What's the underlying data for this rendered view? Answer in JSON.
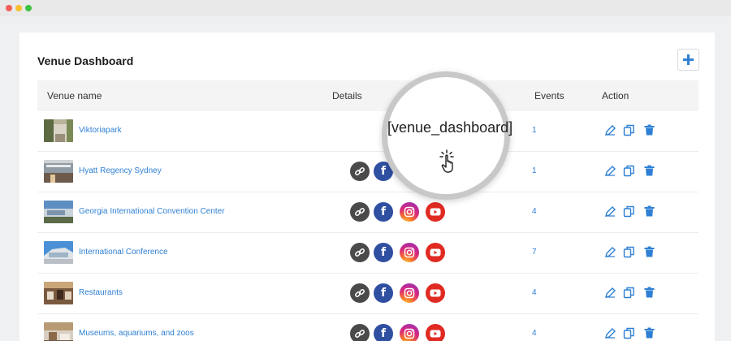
{
  "page": {
    "title": "Venue Dashboard"
  },
  "table": {
    "headers": {
      "venue_name": "Venue name",
      "details": "Details",
      "events": "Events",
      "action": "Action"
    },
    "rows": [
      {
        "name": "Viktoriapark",
        "events": "1"
      },
      {
        "name": "Hyatt Regency Sydney",
        "events": "1"
      },
      {
        "name": "Georgia International Convention Center",
        "events": "4"
      },
      {
        "name": "International Conference",
        "events": "7"
      },
      {
        "name": "Restaurants",
        "events": "4"
      },
      {
        "name": "Museums, aquariums, and zoos",
        "events": "4"
      }
    ]
  },
  "magnifier": {
    "shortcode": "[venue_dashboard]"
  },
  "icons": {
    "add": "plus-icon",
    "link": "link-icon",
    "facebook": "facebook-icon",
    "instagram": "instagram-icon",
    "youtube": "youtube-icon",
    "edit": "pencil-icon",
    "copy": "copy-icon",
    "delete": "trash-icon",
    "cursor": "pointer-click-icon"
  },
  "colors": {
    "accent": "#2f80d4",
    "header_bg": "#f4f4f5",
    "facebook": "#2f4fa1",
    "youtube": "#e02a22",
    "link": "#4a4a4a"
  }
}
